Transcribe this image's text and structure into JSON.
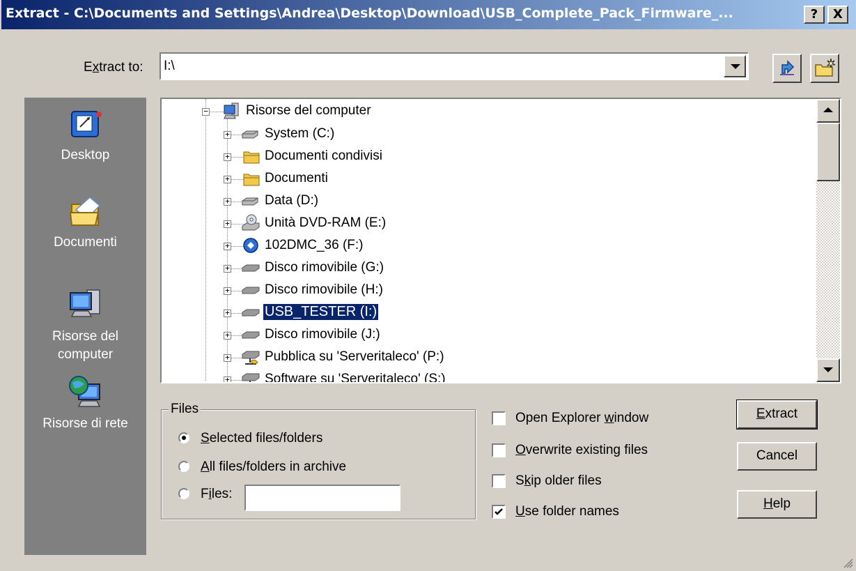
{
  "window": {
    "title": "Extract - C:\\Documents and Settings\\Andrea\\Desktop\\Download\\USB_Complete_Pack_Firmware_...",
    "help_button": "?",
    "close_button": "X"
  },
  "extract_to": {
    "label_pre": "E",
    "label_accel": "x",
    "label_post": "tract to:",
    "value": "I:\\"
  },
  "places": [
    {
      "label": "Desktop",
      "icon": "desktop-icon"
    },
    {
      "label": "Documenti",
      "icon": "documents-folder-icon"
    },
    {
      "label": "Risorse del computer",
      "icon": "my-computer-icon"
    },
    {
      "label": "Risorse di rete",
      "icon": "network-icon"
    }
  ],
  "tree": {
    "root": {
      "label": "Risorse del computer",
      "icon": "my-computer-icon"
    },
    "items": [
      {
        "label": "System (C:)",
        "icon": "hard-drive-icon"
      },
      {
        "label": "Documenti condivisi",
        "icon": "folder-icon"
      },
      {
        "label": "Documenti",
        "icon": "folder-icon"
      },
      {
        "label": "Data (D:)",
        "icon": "hard-drive-icon"
      },
      {
        "label": "Unità DVD-RAM (E:)",
        "icon": "dvd-drive-icon"
      },
      {
        "label": "102DMC_36 (F:)",
        "icon": "camera-drive-icon"
      },
      {
        "label": "Disco rimovibile (G:)",
        "icon": "removable-drive-icon"
      },
      {
        "label": "Disco rimovibile (H:)",
        "icon": "removable-drive-icon"
      },
      {
        "label": "USB_TESTER (I:)",
        "icon": "removable-drive-icon",
        "selected": true
      },
      {
        "label": "Disco rimovibile (J:)",
        "icon": "removable-drive-icon"
      },
      {
        "label": "Pubblica su 'Serveritaleco' (P:)",
        "icon": "network-drive-icon"
      },
      {
        "label": "Software su 'Serveritaleco' (S:)",
        "icon": "network-drive-icon"
      }
    ]
  },
  "files_group": {
    "title": "Files",
    "options": [
      {
        "accel": "S",
        "rest": "elected files/folders",
        "checked": true
      },
      {
        "accel": "A",
        "rest": "ll files/folders in archive",
        "checked": false
      },
      {
        "pre": "F",
        "accel": "i",
        "rest": "les:",
        "checked": false
      }
    ],
    "files_value": ""
  },
  "checkboxes": [
    {
      "pre": "Open Explorer ",
      "accel": "w",
      "rest": "indow",
      "checked": false
    },
    {
      "pre": "",
      "accel": "O",
      "rest": "verwrite existing files",
      "checked": false
    },
    {
      "pre": "S",
      "accel": "k",
      "rest": "ip older files",
      "checked": false
    },
    {
      "pre": "",
      "accel": "U",
      "rest": "se folder names",
      "checked": true
    }
  ],
  "buttons": {
    "extract": {
      "accel": "E",
      "rest": "xtract"
    },
    "cancel": "Cancel",
    "help": {
      "accel": "H",
      "rest": "elp"
    }
  },
  "colors": {
    "titlebar_start": "#0a246a",
    "titlebar_end": "#a6caf0",
    "face": "#d4d0c8",
    "places_bg": "#808080",
    "selection": "#0a246a"
  }
}
